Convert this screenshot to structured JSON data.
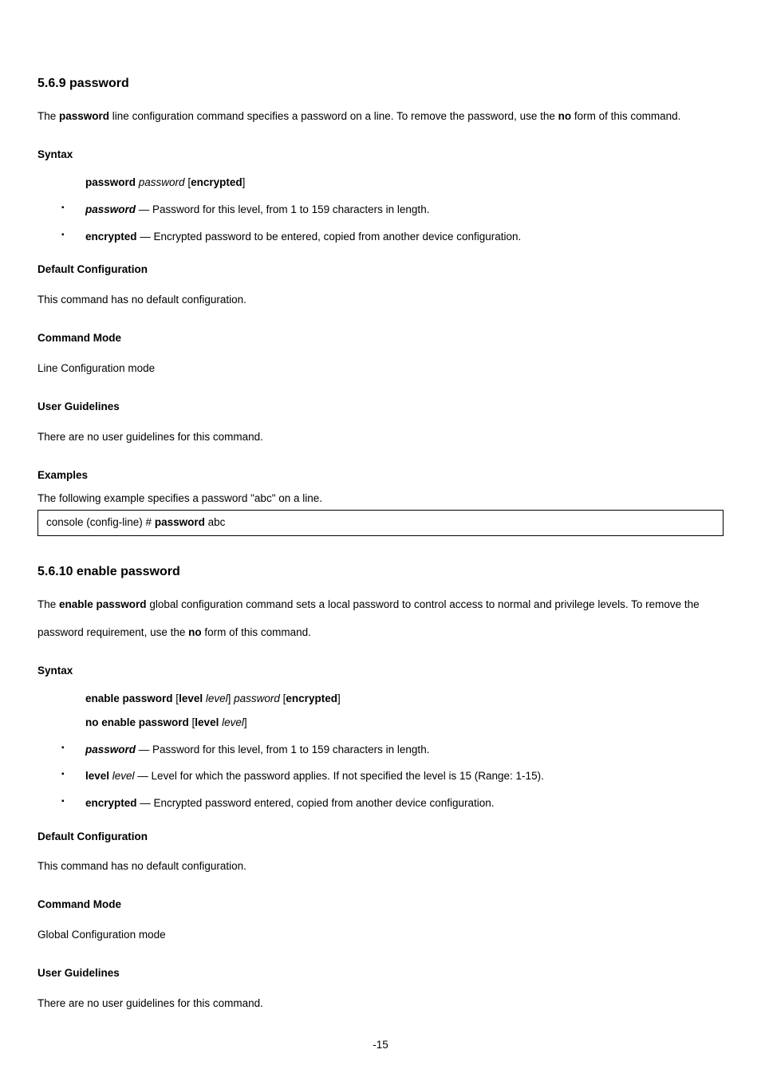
{
  "sec1": {
    "title": "5.6.9  password",
    "intro_prefix": "The ",
    "intro_bold1": "password",
    "intro_mid": " line configuration command specifies a password on a line. To remove the password, use the ",
    "intro_bold2": "no",
    "intro_suffix": " form of this command.",
    "syntax_heading": "Syntax",
    "syntax_line1_bold": "password ",
    "syntax_line1_ital": "password ",
    "syntax_line1_br1": "[",
    "syntax_line1_opt": "encrypted",
    "syntax_line1_br2": "]",
    "param_pw_bold": "password",
    "param_pw_rest": " — Password for this level, from 1 to 159 characters in length.",
    "param_enc_bold": "encrypted",
    "param_enc_rest": " — Encrypted password to be entered, copied from another device configuration.",
    "def_heading": "Default Configuration",
    "def_text": "This command has no default configuration.",
    "mode_heading": "Command Mode",
    "mode_text": "Line Configuration mode",
    "ug_heading": "User Guidelines",
    "ug_text": "There are no user guidelines for this command.",
    "ex_heading": "Examples",
    "ex_text": "The following example specifies a password \"abc\" on a line.",
    "code_prompt": "console (config-line) # ",
    "code_bold": "password",
    "code_arg": " abc"
  },
  "sec2": {
    "title": "5.6.10  enable password",
    "intro_prefix": "The ",
    "intro_bold1": "enable password",
    "intro_mid": " global configuration command sets a local password to control access to normal and privilege levels. To remove the password requirement, use the ",
    "intro_bold2": "no",
    "intro_suffix": " form of this command.",
    "syntax_heading": "Syntax",
    "syntax1_a": "enable password ",
    "syntax1_br1": "[",
    "syntax1_b": "level ",
    "syntax1_c": "level",
    "syntax1_br2": "] ",
    "syntax1_d": "password ",
    "syntax1_br3": "[",
    "syntax1_e": "encrypted",
    "syntax1_br4": "]",
    "syntax2_a": "no enable password ",
    "syntax2_br1": "[",
    "syntax2_b": "level ",
    "syntax2_c": "level",
    "syntax2_br2": "]",
    "param_pw_bold": "password",
    "param_pw_rest": " — Password for this level, from 1 to 159 characters in length.",
    "param_lvl_bold1": "level ",
    "param_lvl_ital": "level",
    "param_lvl_rest": " — Level for which the password applies. If not specified the level is 15 (Range: 1-15).",
    "param_enc_bold": "encrypted",
    "param_enc_rest": " — Encrypted password entered, copied from another device configuration.",
    "def_heading": "Default Configuration",
    "def_text": "This command has no default configuration.",
    "mode_heading": "Command Mode",
    "mode_text": "Global Configuration mode",
    "ug_heading": "User Guidelines",
    "ug_text": "There are no user guidelines for this command."
  },
  "footer": "-15"
}
